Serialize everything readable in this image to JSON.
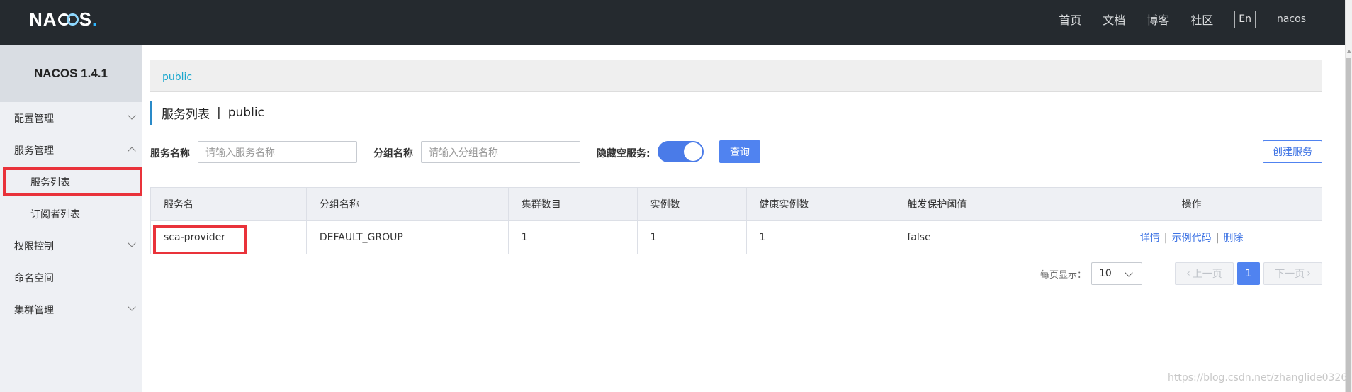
{
  "topbar": {
    "logo": {
      "pre": "NA",
      "post": "S",
      "dot": "."
    },
    "nav": [
      "首页",
      "文档",
      "博客",
      "社区"
    ],
    "lang": "En",
    "user": "nacos"
  },
  "sidebar": {
    "version": "NACOS 1.4.1",
    "items": [
      {
        "label": "配置管理",
        "type": "top",
        "chevron": "down"
      },
      {
        "label": "服务管理",
        "type": "top",
        "chevron": "up"
      },
      {
        "label": "服务列表",
        "type": "sub",
        "active": true
      },
      {
        "label": "订阅者列表",
        "type": "sub"
      },
      {
        "label": "权限控制",
        "type": "top",
        "chevron": "down"
      },
      {
        "label": "命名空间",
        "type": "top"
      },
      {
        "label": "集群管理",
        "type": "top",
        "chevron": "down"
      }
    ]
  },
  "breadcrumb": "public",
  "page_title": {
    "main": "服务列表",
    "sep": "|",
    "namespace": "public"
  },
  "filters": {
    "service_name_label": "服务名称",
    "service_name_placeholder": "请输入服务名称",
    "group_label": "分组名称",
    "group_placeholder": "请输入分组名称",
    "hide_empty_label": "隐藏空服务:",
    "hide_empty_on": true,
    "query_label": "查询",
    "create_label": "创建服务"
  },
  "table": {
    "columns": [
      "服务名",
      "分组名称",
      "集群数目",
      "实例数",
      "健康实例数",
      "触发保护阈值",
      "操作"
    ],
    "rows": [
      {
        "name": "sca-provider",
        "group": "DEFAULT_GROUP",
        "clusters": "1",
        "instances": "1",
        "healthy": "1",
        "threshold": "false"
      }
    ],
    "ops": {
      "detail": "详情",
      "sample": "示例代码",
      "delete": "删除",
      "sep": "|"
    }
  },
  "pagination": {
    "per_page_label": "每页显示：",
    "per_page": "10",
    "prev": "上一页",
    "next": "下一页",
    "current": "1"
  },
  "watermark": "https://blog.csdn.net/zhanglide0326",
  "colors": {
    "topbar": "#252a2f",
    "primary": "#5083f0",
    "highlight": "#e9323a"
  }
}
